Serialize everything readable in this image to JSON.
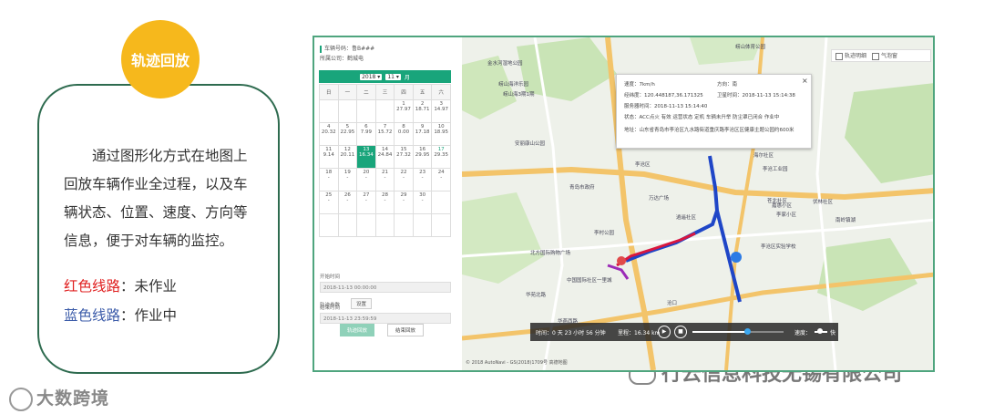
{
  "badge": {
    "label": "轨迹回放"
  },
  "description": "通过图形化方式在地图上回放车辆作业全过程，以及车辆状态、位置、速度、方向等信息，便于对车辆的监控。",
  "legend": {
    "red": {
      "label": "红色线路",
      "suffix": "：未作业",
      "color": "#e02020"
    },
    "blue": {
      "label": "蓝色线路",
      "suffix": "：作业中",
      "color": "#3b5ba9"
    }
  },
  "footer": {
    "brand": "大数跨境",
    "watermark": "行云信息科技无锡有限公司"
  },
  "panel": {
    "plate": "车辆号码：鲁B###",
    "company": "所属公司：鹤城电",
    "year": "2018",
    "month": "11",
    "month_suffix": "月",
    "weekdays": [
      "日",
      "一",
      "二",
      "三",
      "四",
      "五",
      "六"
    ],
    "weeks": [
      [
        {
          "d": ""
        },
        {
          "d": ""
        },
        {
          "d": ""
        },
        {
          "d": ""
        },
        {
          "d": "1",
          "v": "27.97"
        },
        {
          "d": "2",
          "v": "18.71"
        },
        {
          "d": "3",
          "v": "14.97"
        }
      ],
      [
        {
          "d": "4",
          "v": "20.32"
        },
        {
          "d": "5",
          "v": "22.95"
        },
        {
          "d": "6",
          "v": "7.99"
        },
        {
          "d": "7",
          "v": "15.72"
        },
        {
          "d": "8",
          "v": "0.00"
        },
        {
          "d": "9",
          "v": "17.18"
        },
        {
          "d": "10",
          "v": "18.95"
        }
      ],
      [
        {
          "d": "11",
          "v": "9.14"
        },
        {
          "d": "12",
          "v": "20.11"
        },
        {
          "d": "13",
          "v": "16.34",
          "today": true
        },
        {
          "d": "14",
          "v": "24.84"
        },
        {
          "d": "15",
          "v": "27.32"
        },
        {
          "d": "16",
          "v": "29.95"
        },
        {
          "d": "17",
          "v": "29.35",
          "sun": true
        }
      ],
      [
        {
          "d": "18",
          "v": "-"
        },
        {
          "d": "19",
          "v": "-"
        },
        {
          "d": "20",
          "v": "-"
        },
        {
          "d": "21",
          "v": "-"
        },
        {
          "d": "22",
          "v": "-"
        },
        {
          "d": "23",
          "v": "-"
        },
        {
          "d": "24",
          "v": "-"
        }
      ],
      [
        {
          "d": "25",
          "v": "-"
        },
        {
          "d": "26",
          "v": "-"
        },
        {
          "d": "27",
          "v": "-"
        },
        {
          "d": "28",
          "v": "-"
        },
        {
          "d": "29",
          "v": "-"
        },
        {
          "d": "30",
          "v": "-"
        },
        {
          "d": ""
        }
      ],
      [
        {
          "d": ""
        },
        {
          "d": ""
        },
        {
          "d": ""
        },
        {
          "d": ""
        },
        {
          "d": ""
        },
        {
          "d": ""
        },
        {
          "d": ""
        }
      ]
    ],
    "start_label": "开始时间",
    "start_value": "2018-11-13 00:00:00",
    "end_label": "结束时间",
    "end_value": "2018-11-13 23:59:59",
    "param_label": "轨迹参数",
    "settings_btn": "设置",
    "play_btn": "轨迹回放",
    "end_btn": "结束回放"
  },
  "map": {
    "ctrl_detail": "轨迹明细",
    "ctrl_bubble": "气泡窗",
    "popup": {
      "speed": "速度：7km/h",
      "direction": "方向：南",
      "coords": "经纬度：120.448187,36.171325",
      "sat_time": "卫星时间：2018-11-13 15:14:38",
      "server_time": "服务器时间：2018-11-13 15:14:40",
      "status": "状态：ACC点火 有效 运营状态 定机 车辆未升举 防尘罩已闭合 作业中",
      "address": "地址：山东省青岛市李沧区九水路街道重庆路李沧区区健康主题公园约600米",
      "close": "×"
    },
    "playbar": {
      "time": "时间：0 天 23 小时 56 分钟",
      "mileage": "里程：16.34 km",
      "speed": "速度：",
      "fast": "快"
    },
    "credit": "© 2018 AutoNavi - GS(2018)1709号 高德地图",
    "progress": 0.6,
    "speed_level": 0.4,
    "pois": [
      "金水河湿地公园",
      "崂山海洋乐园",
      "崂山海3期1期",
      "崂山体育公园",
      "安丽康山公园",
      "李沧区",
      "青岛市政府",
      "万达广场",
      "北方国际购物广场",
      "中国国际社区一里城",
      "李村公园",
      "华苑北路",
      "华燕西路",
      "沧口",
      "逍遥社区",
      "海尔社区",
      "李沧工业园",
      "苍北社区",
      "嘉惠小区",
      "李家小区",
      "李沧区实验学校",
      "伏林社区",
      "南岭镇湖"
    ],
    "colors": {
      "red": "#d9173f",
      "blue": "#1f46c7",
      "road": "#f3c46a"
    }
  }
}
